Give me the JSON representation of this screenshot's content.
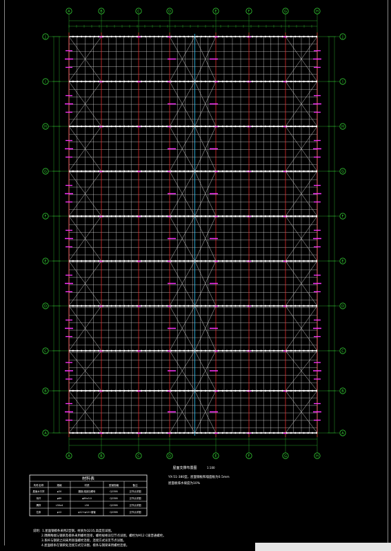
{
  "grid": {
    "columns": [
      "A",
      "B",
      "C",
      "D",
      "E",
      "F",
      "G",
      "H"
    ],
    "rows": [
      "A",
      "B",
      "C",
      "D",
      "E",
      "F",
      "G",
      "H",
      "I",
      "J"
    ]
  },
  "notes": {
    "plan_title": "屋面支撑布置图",
    "plan_scale": "1:100",
    "remark_line1": "YX-51-380型，屋面钢板和墙面板为0.5mm",
    "remark_line2": "屋面板排水坡度为10%"
  },
  "table": {
    "title": "材料表",
    "headers": [
      "构件名称",
      "规格",
      "材质",
      "型钢规格",
      "备注"
    ],
    "rows": [
      [
        "屋面水平撑",
        "φ20",
        "圆钢,端部加螺母",
        "Q235B",
        "见节点详图"
      ],
      [
        "系杆",
        "φ89",
        "φ89x3.0",
        "Q235B",
        "见节点详图"
      ],
      [
        "隅撑",
        "L50x4",
        "L50",
        "Q235B",
        "见节点详图"
      ],
      [
        "拉条",
        "φ12",
        "φ12+φ12+套管",
        "Q235B",
        "见节点详图"
      ]
    ]
  },
  "footnotes": [
    "说明：1.屋面钢檩条采用Z型钢，材质为Q235,高度见详图。",
    "2.隅撑两端与钢梁及檩条采用螺栓连接，螺栓规格详见节点详图，螺栓为M12 C级普通螺栓。",
    "3.系杆与钢梁之间采用高强螺栓连接，连接方式详见节点详图。",
    "4.屋面檩条在钢梁处连接方式见详图，檩条与钢梁采用螺栓连接。"
  ],
  "colors": {
    "background": "#000000",
    "axis": "#33cc33",
    "grid": "#ffffff",
    "bracing": "#ff33ff",
    "column_line": "#ff3333",
    "ridge": "#33ccff",
    "dimension": "#33cc33"
  }
}
